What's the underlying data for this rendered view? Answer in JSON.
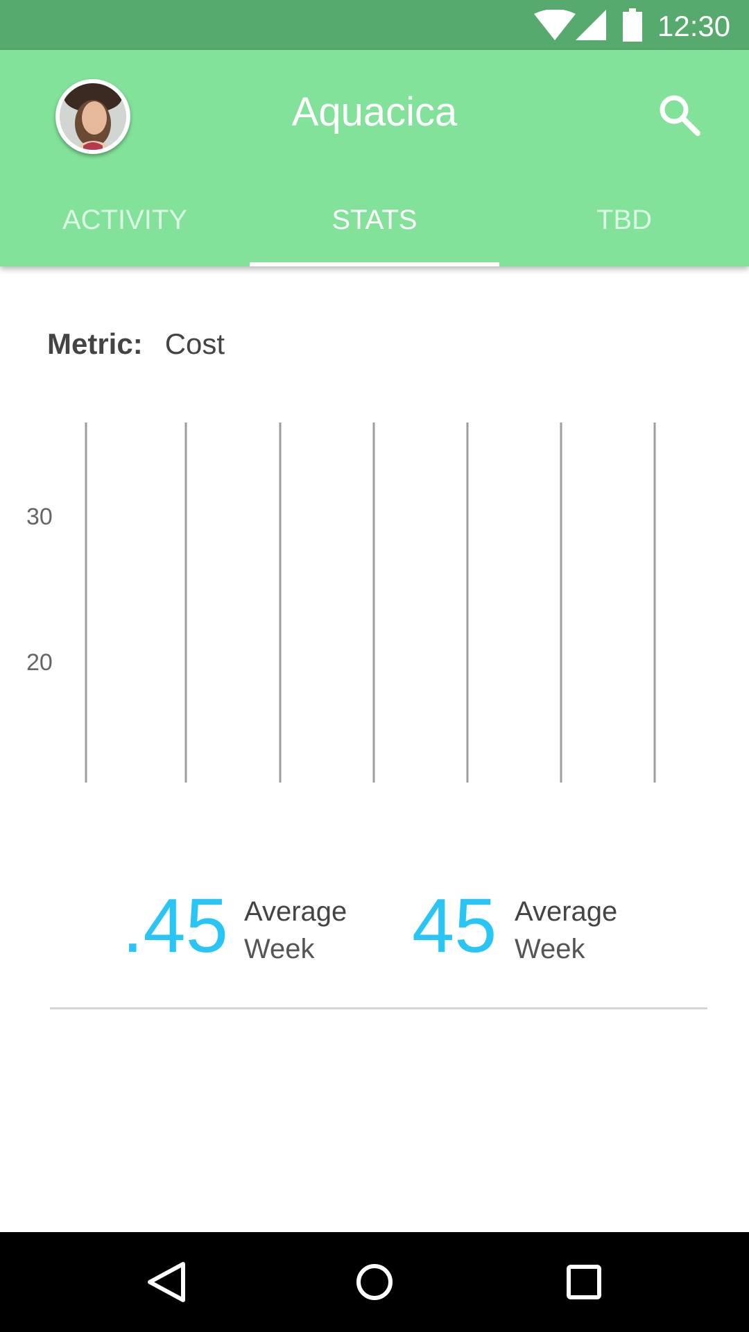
{
  "status_bar": {
    "time": "12:30",
    "icons": [
      "wifi-icon",
      "cell-signal-icon",
      "battery-icon"
    ]
  },
  "app_bar": {
    "title": "Aquacica",
    "avatar": "user-avatar",
    "search_icon": "search-icon",
    "tabs": [
      {
        "label": "ACTIVITY",
        "active": false
      },
      {
        "label": "STATS",
        "active": true
      },
      {
        "label": "TBD",
        "active": false
      }
    ]
  },
  "metric": {
    "label": "Metric:",
    "value": "Cost"
  },
  "chart_data": {
    "type": "bar",
    "y_ticks": [
      "30",
      "20"
    ],
    "bar_count": 7,
    "values": [],
    "grid": true
  },
  "stats": [
    {
      "value": ".45",
      "label": "Average",
      "period": "Week"
    },
    {
      "value": "45",
      "label": "Average",
      "period": "Week"
    }
  ],
  "nav_bar": {
    "buttons": [
      "back-icon",
      "home-icon",
      "recents-icon"
    ]
  },
  "colors": {
    "status_bar": "#57aa6e",
    "app_bar": "#82e29a",
    "accent": "#29c5f6"
  }
}
